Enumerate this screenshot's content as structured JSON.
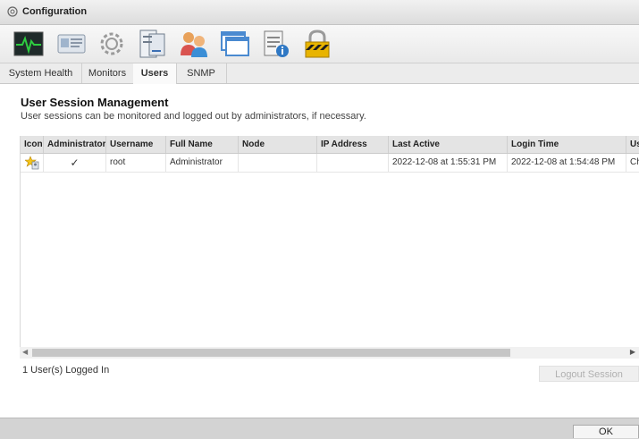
{
  "window": {
    "title": "Configuration"
  },
  "toolbar_icons": [
    "system-health-icon",
    "monitors-icon",
    "settings-icon",
    "server-icon",
    "users-icon",
    "windows-icon",
    "notes-info-icon",
    "lock-icon"
  ],
  "tabs": [
    {
      "label": "System Health",
      "active": false
    },
    {
      "label": "Monitors",
      "active": false
    },
    {
      "label": "Users",
      "active": true
    },
    {
      "label": "SNMP",
      "active": false
    }
  ],
  "section": {
    "title": "User Session Management",
    "description": "User sessions can be monitored and logged out by administrators, if necessary."
  },
  "table": {
    "columns": [
      "Icon",
      "Administrator",
      "Username",
      "Full Name",
      "Node",
      "IP Address",
      "Last Active",
      "Login Time",
      "Us"
    ],
    "rows": [
      {
        "icon": "admin-user-icon",
        "administrator": "✓",
        "username": "root",
        "full_name": "Administrator",
        "node": "",
        "ip_address": "",
        "last_active": "2022-12-08 at 1:55:31 PM",
        "login_time": "2022-12-08 at 1:54:48 PM",
        "user_agent": "Ch"
      }
    ]
  },
  "status": {
    "logged_in": "1 User(s) Logged In"
  },
  "buttons": {
    "logout": "Logout Session",
    "ok": "OK"
  },
  "colors": {
    "health_green": "#2ecc40",
    "lock_gold": "#e8b400",
    "header_bg": "#e4e4e4"
  }
}
